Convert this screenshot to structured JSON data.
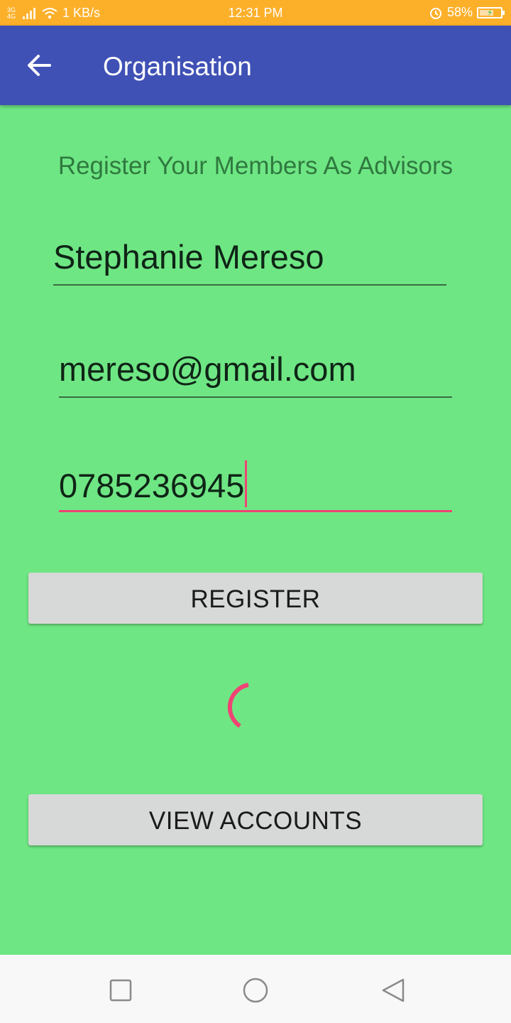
{
  "status_bar": {
    "network_label": "3G 4G",
    "speed": "1 KB/s",
    "time": "12:31 PM",
    "battery": "58%",
    "icons": [
      "signal-icon",
      "wifi-icon",
      "alarm-icon",
      "battery-icon"
    ]
  },
  "app_bar": {
    "title": "Organisation",
    "back_icon": "arrow-left-icon",
    "background": "#3f51b5"
  },
  "form": {
    "subtitle": "Register Your Members As Advisors",
    "name_value": "Stephanie Mereso",
    "email_value": "mereso@gmail.com",
    "phone_value": "0785236945"
  },
  "buttons": {
    "register_label": "REGISTER",
    "view_accounts_label": "VIEW ACCOUNTS"
  },
  "colors": {
    "status_bar": "#fcb02a",
    "background": "#6fe684",
    "accent": "#f04374",
    "button": "#d7d8d8"
  },
  "nav_bar": {
    "icons": [
      "recent-apps-icon",
      "home-icon",
      "back-triangle-icon"
    ]
  }
}
